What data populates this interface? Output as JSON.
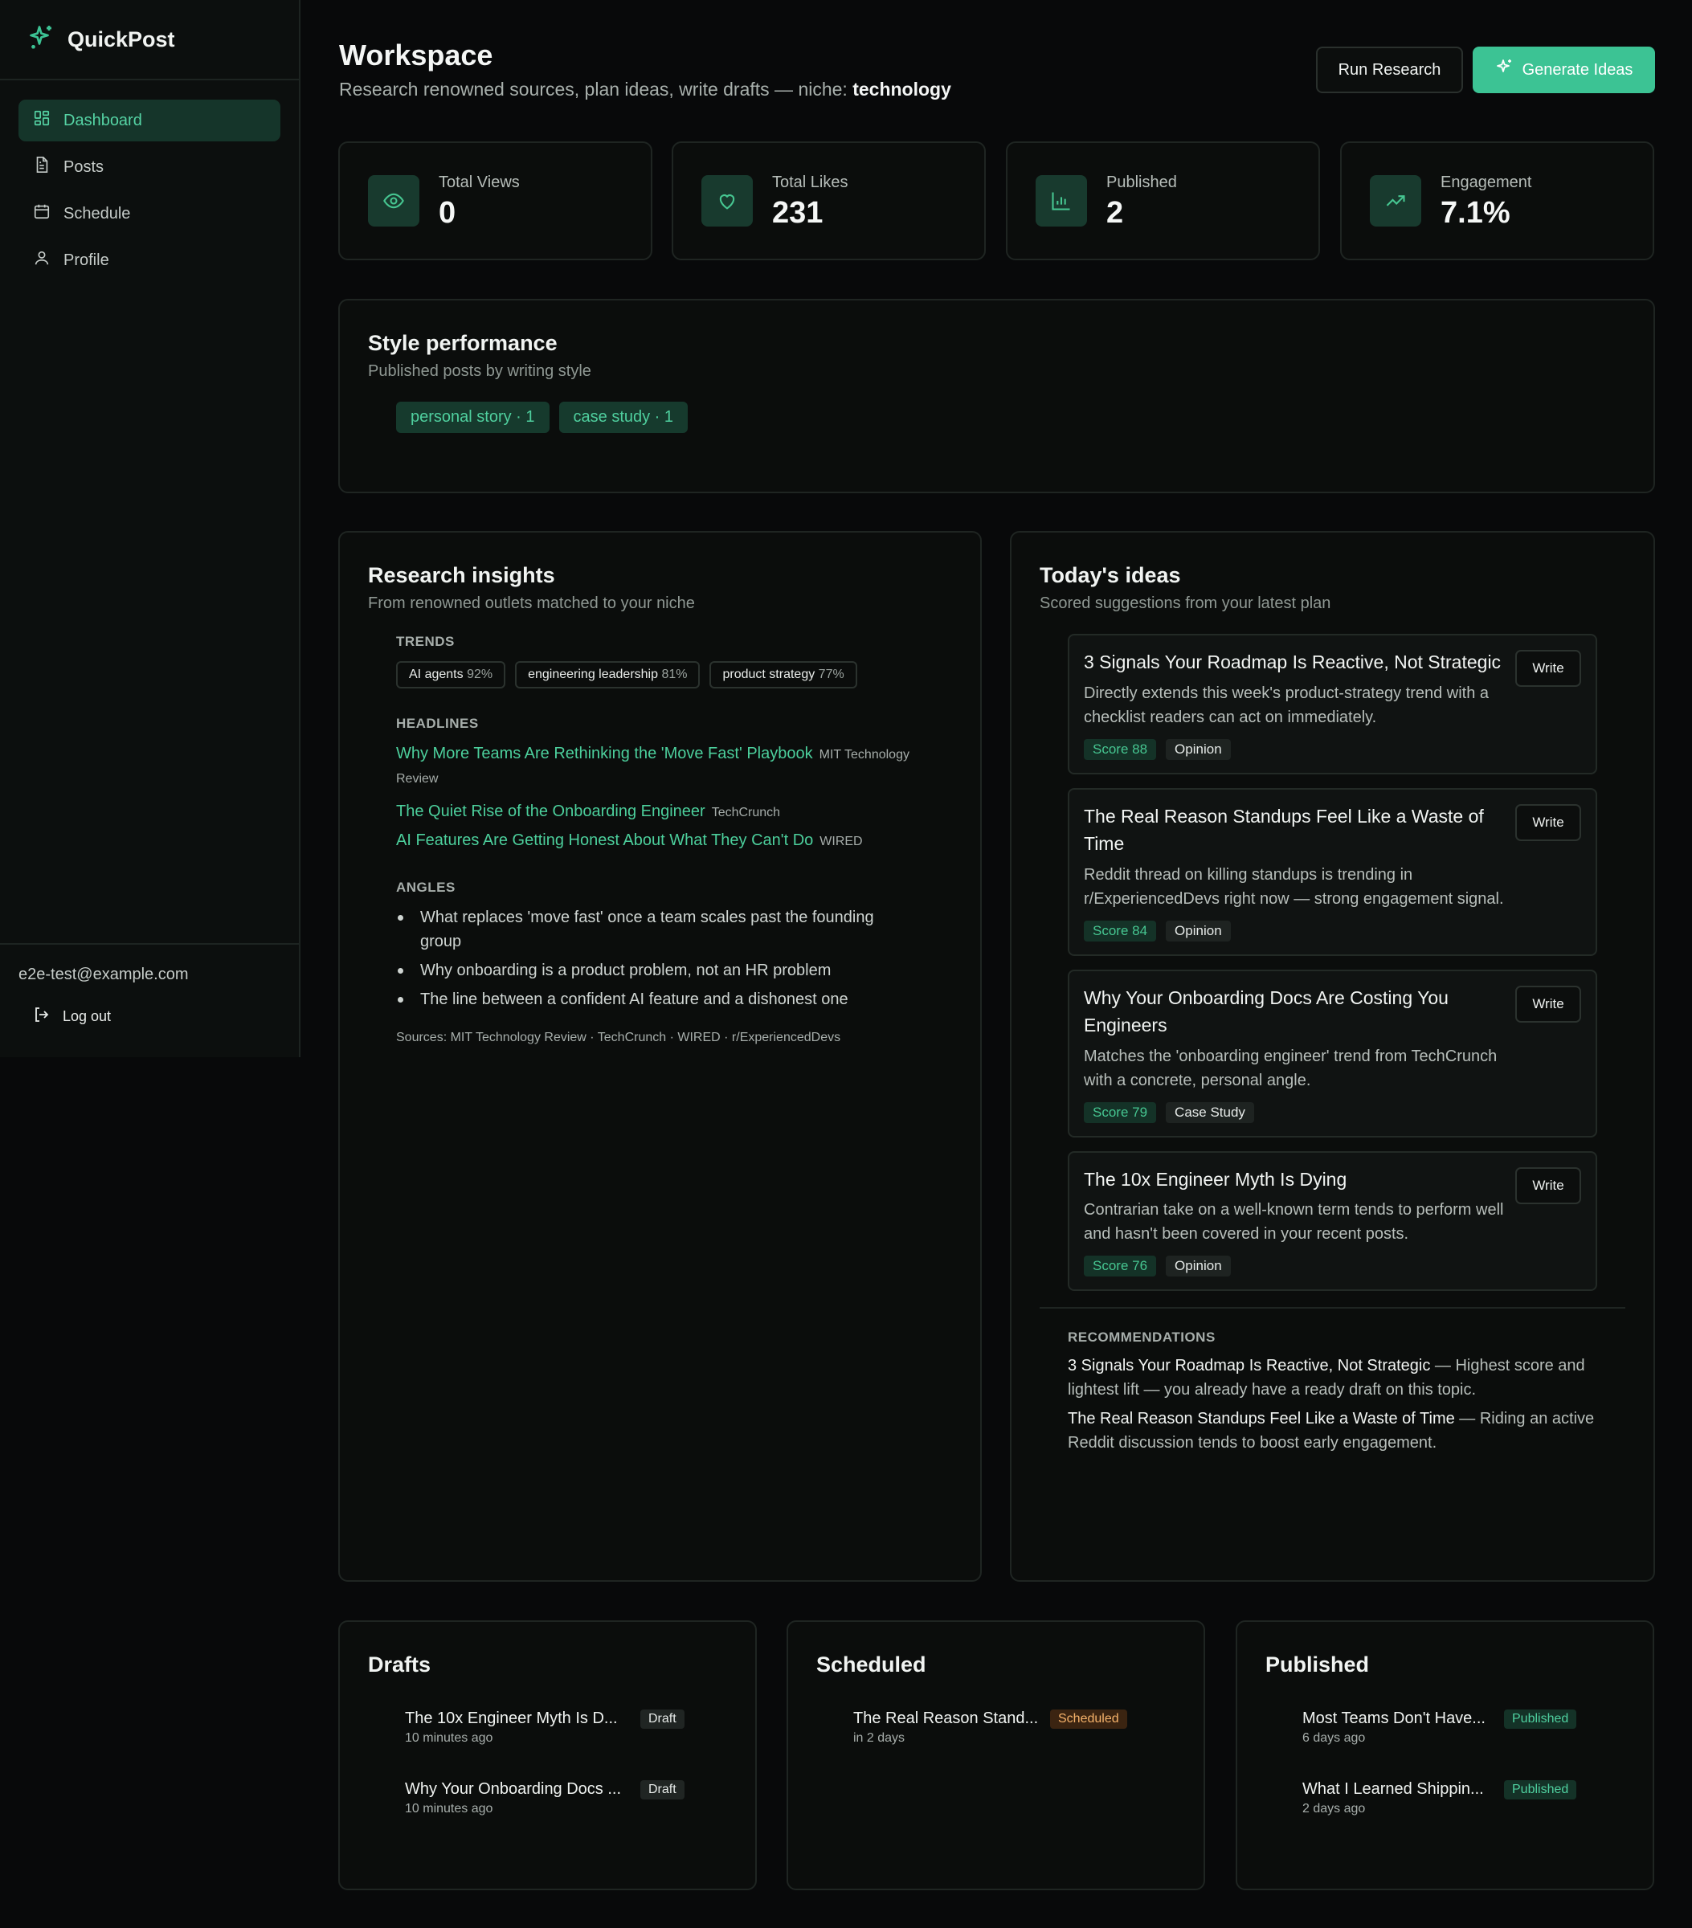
{
  "sidebar": {
    "brand": "QuickPost",
    "nav": [
      "Dashboard",
      "Posts",
      "Schedule",
      "Profile"
    ],
    "email": "e2e-test@example.com",
    "logout": "Log out"
  },
  "header": {
    "title": "Workspace",
    "subtitle_prefix": "Research renowned sources, plan ideas, write drafts — niche:",
    "niche": "technology",
    "run_research": "Run Research",
    "generate_ideas": "Generate Ideas"
  },
  "stats": [
    {
      "label": "Total Views",
      "value": "0",
      "icon": "eye-icon"
    },
    {
      "label": "Total Likes",
      "value": "231",
      "icon": "heart-icon"
    },
    {
      "label": "Published",
      "value": "2",
      "icon": "bar-chart-icon"
    },
    {
      "label": "Engagement",
      "value": "7.1%",
      "icon": "trending-up-icon"
    }
  ],
  "style": {
    "title": "Style performance",
    "subtitle": "Published posts by writing style",
    "chips": [
      "personal story · 1",
      "case study · 1"
    ]
  },
  "research": {
    "title": "Research insights",
    "subtitle": "From renowned outlets matched to your niche",
    "trends_label": "TRENDS",
    "trends": [
      {
        "name": "AI agents",
        "pct": "92%"
      },
      {
        "name": "engineering leadership",
        "pct": "81%"
      },
      {
        "name": "product strategy",
        "pct": "77%"
      }
    ],
    "headlines_label": "HEADLINES",
    "headlines": [
      {
        "title": "Why More Teams Are Rethinking the 'Move Fast' Playbook",
        "source": "MIT Technology Review"
      },
      {
        "title": "The Quiet Rise of the Onboarding Engineer",
        "source": "TechCrunch"
      },
      {
        "title": "AI Features Are Getting Honest About What They Can't Do",
        "source": "WIRED"
      }
    ],
    "angles_label": "ANGLES",
    "angles": [
      "What replaces 'move fast' once a team scales past the founding group",
      "Why onboarding is a product problem, not an HR problem",
      "The line between a confident AI feature and a dishonest one"
    ],
    "sources": "Sources: MIT Technology Review · TechCrunch · WIRED · r/ExperiencedDevs"
  },
  "ideas": {
    "title": "Today's ideas",
    "subtitle": "Scored suggestions from your latest plan",
    "write_label": "Write",
    "items": [
      {
        "title": "3 Signals Your Roadmap Is Reactive, Not Strategic",
        "desc": "Directly extends this week's product-strategy trend with a checklist readers can act on immediately.",
        "score": "Score 88",
        "type": "Opinion"
      },
      {
        "title": "The Real Reason Standups Feel Like a Waste of Time",
        "desc": "Reddit thread on killing standups is trending in r/ExperiencedDevs right now — strong engagement signal.",
        "score": "Score 84",
        "type": "Opinion"
      },
      {
        "title": "Why Your Onboarding Docs Are Costing You Engineers",
        "desc": "Matches the 'onboarding engineer' trend from TechCrunch with a concrete, personal angle.",
        "score": "Score 79",
        "type": "Case Study"
      },
      {
        "title": "The 10x Engineer Myth Is Dying",
        "desc": "Contrarian take on a well-known term tends to perform well and hasn't been covered in your recent posts.",
        "score": "Score 76",
        "type": "Opinion"
      }
    ],
    "rec_label": "RECOMMENDATIONS",
    "recommendations": [
      {
        "title": "3 Signals Your Roadmap Is Reactive, Not Strategic",
        "text": " — Highest score and lightest lift — you already have a ready draft on this topic."
      },
      {
        "title": "The Real Reason Standups Feel Like a Waste of Time",
        "text": " — Riding an active Reddit discussion tends to boost early engagement."
      }
    ]
  },
  "drafts": {
    "title": "Drafts",
    "items": [
      {
        "title": "The 10x Engineer Myth Is D...",
        "time": "10 minutes ago",
        "badge": "Draft"
      },
      {
        "title": "Why Your Onboarding Docs ...",
        "time": "10 minutes ago",
        "badge": "Draft"
      }
    ]
  },
  "scheduled": {
    "title": "Scheduled",
    "items": [
      {
        "title": "The Real Reason Stand...",
        "time": "in 2 days",
        "badge": "Scheduled"
      }
    ]
  },
  "published": {
    "title": "Published",
    "items": [
      {
        "title": "Most Teams Don't Have...",
        "time": "6 days ago",
        "badge": "Published"
      },
      {
        "title": "What I Learned Shippin...",
        "time": "2 days ago",
        "badge": "Published"
      }
    ]
  },
  "colors": {
    "accent": "#3cc394",
    "background": "#08090a",
    "card": "#0b0d0c",
    "scheduled": "#f5b26a"
  }
}
